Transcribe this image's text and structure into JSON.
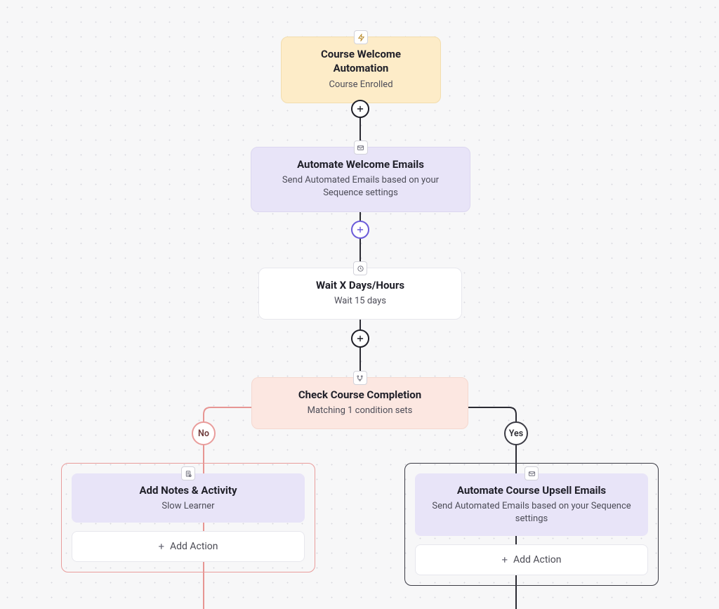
{
  "nodes": {
    "trigger": {
      "icon": "lightning-icon",
      "title": "Course Welcome Automation",
      "subtitle": "Course Enrolled"
    },
    "welcome": {
      "icon": "mail-icon",
      "title": "Automate Welcome Emails",
      "subtitle": "Send Automated Emails based on your Sequence settings"
    },
    "wait": {
      "icon": "clock-icon",
      "title": "Wait X Days/Hours",
      "subtitle": "Wait 15 days"
    },
    "check": {
      "icon": "branch-icon",
      "title": "Check Course Completion",
      "subtitle": "Matching 1 condition sets"
    }
  },
  "branches": {
    "no": {
      "label": "No",
      "card": {
        "icon": "note-icon",
        "title": "Add Notes & Activity",
        "subtitle": "Slow Learner"
      },
      "add_action": "Add Action"
    },
    "yes": {
      "label": "Yes",
      "card": {
        "icon": "mail-icon",
        "title": "Automate Course Upsell Emails",
        "subtitle": "Send Automated Emails based on your Sequence settings"
      },
      "add_action": "Add Action"
    }
  },
  "chart_data": {
    "type": "flowchart",
    "title": "Course Welcome Automation",
    "nodes": [
      {
        "id": "trigger",
        "type": "trigger",
        "label": "Course Welcome Automation",
        "detail": "Course Enrolled"
      },
      {
        "id": "welcome",
        "type": "action",
        "label": "Automate Welcome Emails",
        "detail": "Send Automated Emails based on your Sequence settings"
      },
      {
        "id": "wait",
        "type": "delay",
        "label": "Wait X Days/Hours",
        "detail": "Wait 15 days"
      },
      {
        "id": "check",
        "type": "condition",
        "label": "Check Course Completion",
        "detail": "Matching 1 condition sets"
      },
      {
        "id": "no_notes",
        "type": "action",
        "label": "Add Notes & Activity",
        "detail": "Slow Learner"
      },
      {
        "id": "yes_upsell",
        "type": "action",
        "label": "Automate Course Upsell Emails",
        "detail": "Send Automated Emails based on your Sequence settings"
      }
    ],
    "edges": [
      {
        "from": "trigger",
        "to": "welcome"
      },
      {
        "from": "welcome",
        "to": "wait"
      },
      {
        "from": "wait",
        "to": "check"
      },
      {
        "from": "check",
        "to": "no_notes",
        "label": "No"
      },
      {
        "from": "check",
        "to": "yes_upsell",
        "label": "Yes"
      }
    ]
  }
}
